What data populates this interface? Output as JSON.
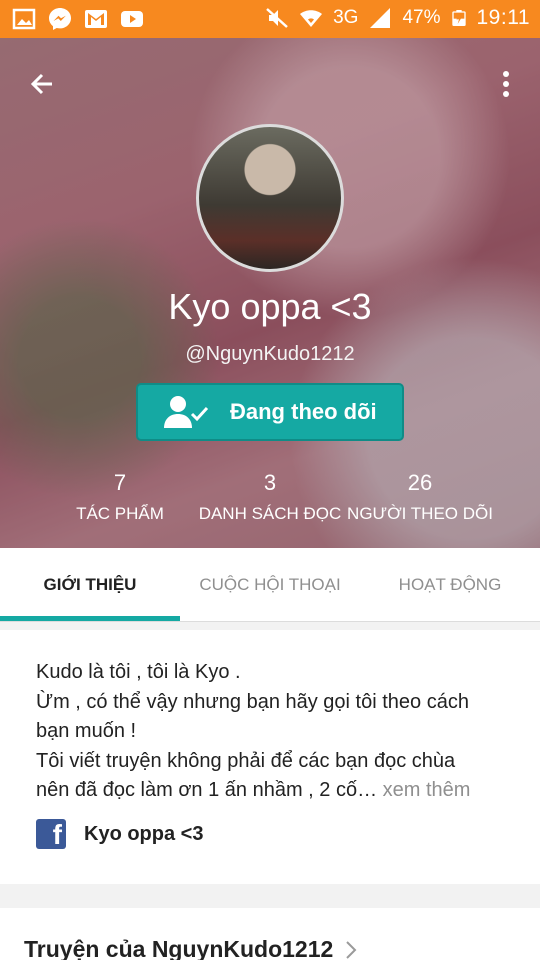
{
  "status_bar": {
    "network": "3G",
    "battery": "47%",
    "time": "19:11"
  },
  "profile": {
    "display_name": "Kyo oppa <3",
    "username": "@NguynKudo1212",
    "follow_label": "Đang theo dõi"
  },
  "stats": [
    {
      "value": "7",
      "label": "TÁC PHẨM"
    },
    {
      "value": "3",
      "label": "DANH SÁCH ĐỌC"
    },
    {
      "value": "26",
      "label": "NGƯỜI THEO DÕI"
    }
  ],
  "tabs": [
    {
      "label": "GIỚI THIỆU"
    },
    {
      "label": "CUỘC HỘI THOẠI"
    },
    {
      "label": "HOẠT ĐỘNG"
    }
  ],
  "about": {
    "line1": "Kudo là tôi , tôi là Kyo .",
    "line2": "Ừm , có thể vậy nhưng bạn hãy gọi tôi theo cách",
    "line3": "bạn muốn !",
    "line4": "Tôi viết truyện không phải để các bạn đọc chùa",
    "line5": "nên đã đọc làm ơn 1 ấn nhầm , 2 cố",
    "ellipsis": "…",
    "see_more": " xem thêm",
    "facebook_name": "Kyo oppa <3"
  },
  "stories": {
    "title": "Truyện của NguynKudo1212"
  },
  "colors": {
    "status_bar": "#f7891f",
    "accent": "#15a9a3",
    "facebook": "#3b5998"
  }
}
